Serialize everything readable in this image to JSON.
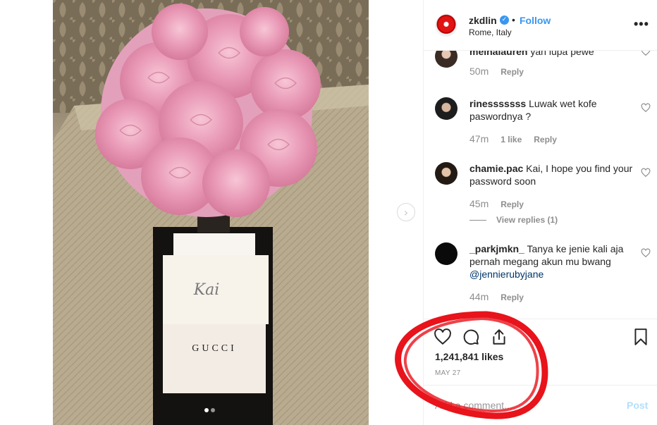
{
  "header": {
    "username": "zkdlin",
    "separator": "•",
    "follow_label": "Follow",
    "location": "Rome, Italy",
    "more_label": "•••"
  },
  "photo": {
    "card_signature": "Kai",
    "box_brand": "GUCCI"
  },
  "comments": [
    {
      "user": "melnalauren",
      "text": "yah lupa pewe",
      "time": "50m",
      "likes": "",
      "reply_label": "Reply"
    },
    {
      "user": "rinesssssss",
      "text": "Luwak wet kofe paswordnya ?",
      "time": "47m",
      "likes": "1 like",
      "reply_label": "Reply"
    },
    {
      "user": "chamie.pac",
      "text": "Kai, I hope you find your password soon",
      "time": "45m",
      "likes": "",
      "reply_label": "Reply",
      "view_replies": "View replies (1)"
    },
    {
      "user": "_parkjmkn_",
      "text": "Tanya ke jenie kali aja pernah megang akun mu bwang",
      "mention": "@jennierubyjane",
      "time": "44m",
      "likes": "",
      "reply_label": "Reply"
    }
  ],
  "actions": {
    "likes": "1,241,841 likes",
    "date": "MAY 27"
  },
  "add_comment": {
    "placeholder": "Add a comment...",
    "post_label": "Post"
  },
  "colors": {
    "link_blue": "#3897f0",
    "annotation_red": "#e8131b",
    "post_disabled": "#b2dffc"
  },
  "icons": [
    "chevron-right-icon",
    "verified-badge-icon",
    "more-options-icon",
    "heart-icon",
    "comment-icon",
    "share-icon",
    "bookmark-icon"
  ]
}
